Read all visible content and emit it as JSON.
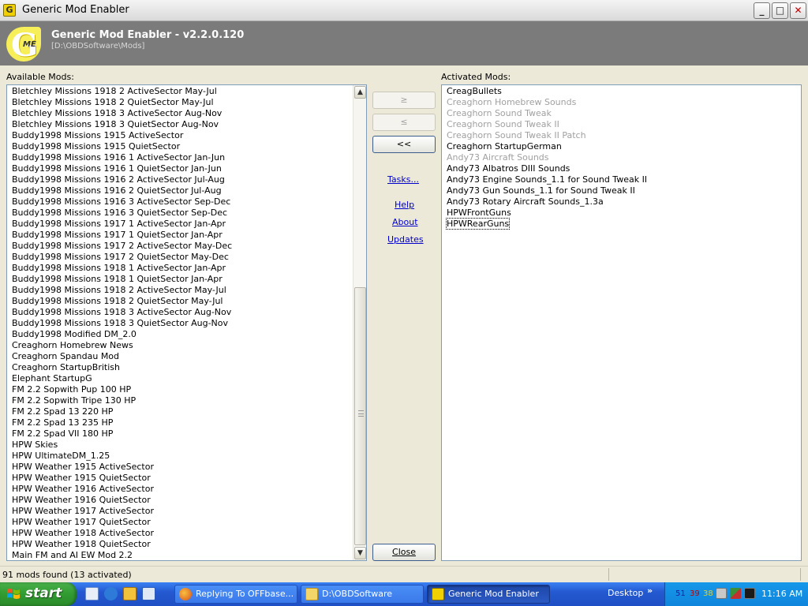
{
  "window": {
    "title": "Generic Mod Enabler",
    "icon_label": "G",
    "controls": {
      "minimize": "_",
      "maximize": "□",
      "close": "✕"
    }
  },
  "header": {
    "logo_letter": "G",
    "logo_sub": "ME",
    "app_title": "Generic Mod Enabler - v2.2.0.120",
    "path": "[D:\\OBDSoftware\\Mods]"
  },
  "available": {
    "label": "Available Mods:",
    "items": [
      "Bletchley Missions 1918 2 ActiveSector May-Jul",
      "Bletchley Missions 1918 2 QuietSector May-Jul",
      "Bletchley Missions 1918 3 ActiveSector Aug-Nov",
      "Bletchley Missions 1918 3 QuietSector Aug-Nov",
      "Buddy1998 Missions 1915 ActiveSector",
      "Buddy1998 Missions 1915 QuietSector",
      "Buddy1998 Missions 1916 1 ActiveSector Jan-Jun",
      "Buddy1998 Missions 1916 1 QuietSector Jan-Jun",
      "Buddy1998 Missions 1916 2 ActiveSector Jul-Aug",
      "Buddy1998 Missions 1916 2 QuietSector Jul-Aug",
      "Buddy1998 Missions 1916 3 ActiveSector Sep-Dec",
      "Buddy1998 Missions 1916 3 QuietSector Sep-Dec",
      "Buddy1998 Missions 1917 1 ActiveSector Jan-Apr",
      "Buddy1998 Missions 1917 1 QuietSector Jan-Apr",
      "Buddy1998 Missions 1917 2 ActiveSector May-Dec",
      "Buddy1998 Missions 1917 2 QuietSector May-Dec",
      "Buddy1998 Missions 1918 1 ActiveSector Jan-Apr",
      "Buddy1998 Missions 1918 1 QuietSector Jan-Apr",
      "Buddy1998 Missions 1918 2 ActiveSector May-Jul",
      "Buddy1998 Missions 1918 2 QuietSector May-Jul",
      "Buddy1998 Missions 1918 3 ActiveSector Aug-Nov",
      "Buddy1998 Missions 1918 3 QuietSector Aug-Nov",
      "Buddy1998 Modified DM_2.0",
      "Creaghorn Homebrew News",
      "Creaghorn Spandau Mod",
      "Creaghorn StartupBritish",
      "Elephant StartupG",
      "FM 2.2 Sopwith Pup 100 HP",
      "FM 2.2 Sopwith Tripe 130 HP",
      "FM 2.2 Spad 13 220 HP",
      "FM 2.2 Spad 13 235 HP",
      "FM 2.2 Spad VII 180 HP",
      "HPW Skies",
      "HPW UltimateDM_1.25",
      "HPW Weather 1915 ActiveSector",
      "HPW Weather 1915 QuietSector",
      "HPW Weather 1916 ActiveSector",
      "HPW Weather 1916 QuietSector",
      "HPW Weather 1917 ActiveSector",
      "HPW Weather 1917 QuietSector",
      "HPW Weather 1918 ActiveSector",
      "HPW Weather 1918 QuietSector",
      "Main FM and AI EW Mod 2.2"
    ]
  },
  "activated": {
    "label": "Activated Mods:",
    "items": [
      {
        "name": "CreagBullets",
        "enabled": true
      },
      {
        "name": "Creaghorn Homebrew Sounds",
        "enabled": false
      },
      {
        "name": "Creaghorn Sound Tweak",
        "enabled": false
      },
      {
        "name": "Creaghorn Sound Tweak II",
        "enabled": false
      },
      {
        "name": "Creaghorn Sound Tweak II Patch",
        "enabled": false
      },
      {
        "name": "Creaghorn StartupGerman",
        "enabled": true
      },
      {
        "name": "Andy73 Aircraft Sounds",
        "enabled": false
      },
      {
        "name": "Andy73 Albatros DIII Sounds",
        "enabled": true
      },
      {
        "name": "Andy73 Engine Sounds_1.1 for Sound Tweak II",
        "enabled": true
      },
      {
        "name": "Andy73 Gun Sounds_1.1 for Sound Tweak II",
        "enabled": true
      },
      {
        "name": "Andy73 Rotary Aircraft Sounds_1.3a",
        "enabled": true
      },
      {
        "name": "HPWFrontGuns",
        "enabled": true
      },
      {
        "name": "HPWRearGuns",
        "enabled": true,
        "focused": true
      }
    ]
  },
  "buttons": {
    "add": "≥",
    "remove": "≤",
    "remove_all": "<<",
    "close": "Close"
  },
  "links": {
    "tasks": "Tasks...",
    "help": "Help",
    "about": "About",
    "updates": "Updates"
  },
  "scrollbar": {
    "up": "▲",
    "down": "▼"
  },
  "status": {
    "text": "91 mods found (13 activated)"
  },
  "taskbar": {
    "start_label": "start",
    "tasks": [
      {
        "label": "Replying To OFFbase...",
        "icon": "firefox-icon",
        "active": false
      },
      {
        "label": "D:\\OBDSoftware",
        "icon": "folder-icon",
        "active": false
      },
      {
        "label": "Generic Mod Enabler",
        "icon": "gme-icon",
        "active": true
      }
    ],
    "desktop_label": "Desktop",
    "chevron": "»",
    "tray_numbers": [
      "51",
      "39",
      "38"
    ],
    "clock": "11:16 AM"
  },
  "colors": {
    "banner": "#7b7b7b",
    "list_border": "#7f9db9",
    "link": "#0000cc",
    "disabled_text": "#a0a0a0",
    "taskbar": "#2459d1",
    "start": "#319b31"
  }
}
